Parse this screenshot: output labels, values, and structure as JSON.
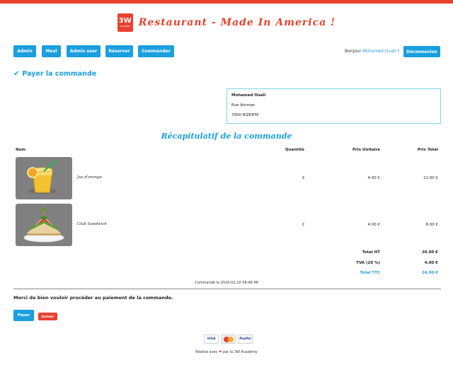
{
  "header": {
    "logo_big": "3W",
    "logo_small": "ACADEMY",
    "title": "Restaurant - Made In America !"
  },
  "nav": {
    "items": [
      "Admin",
      "Meal",
      "Admin user",
      "Réserver",
      "Commander"
    ],
    "greeting": "Bonjour",
    "user_name": "Mohamed Ouali",
    "greeting_suffix": "!",
    "logout": "Déconnexion"
  },
  "page": {
    "title": "Payer la commande"
  },
  "address": {
    "name": "Mohamed Ouali",
    "street": "Rue Amman",
    "city": "7000 BIZERTE"
  },
  "recap": {
    "title": "Récapitulatif de la commande",
    "columns": [
      "Nom",
      "Quantité",
      "Prix Unitaire",
      "Prix Total"
    ],
    "rows": [
      {
        "name": "Jus d'orange",
        "qty": "3",
        "unit": "4.00 €",
        "total": "12.00 €",
        "image": "orange-juice"
      },
      {
        "name": "Club Sandwich",
        "qty": "2",
        "unit": "4.00 €",
        "total": "8.00 €",
        "image": "club-sandwich"
      }
    ],
    "totals": [
      {
        "label": "Total HT",
        "value": "20.00 €"
      },
      {
        "label": "TVA (20 %)",
        "value": "4.00 €"
      },
      {
        "label": "Total TTC",
        "value": "24.00 €"
      }
    ],
    "ordered_at": "Commandé le 2020-02-10 08:46:48"
  },
  "payment": {
    "message": "Merci de bien vouloir procéder au paiement de la commande.",
    "pay_label": "Payer",
    "cancel_label": "Annuler",
    "cards": [
      "VISA",
      "MasterCard",
      "PayPal"
    ]
  },
  "footer": {
    "prefix": "Réalisé avec",
    "suffix": "par la 3W Academy"
  },
  "colors": {
    "accent": "#1a9fe0",
    "brand": "#e8422e"
  }
}
